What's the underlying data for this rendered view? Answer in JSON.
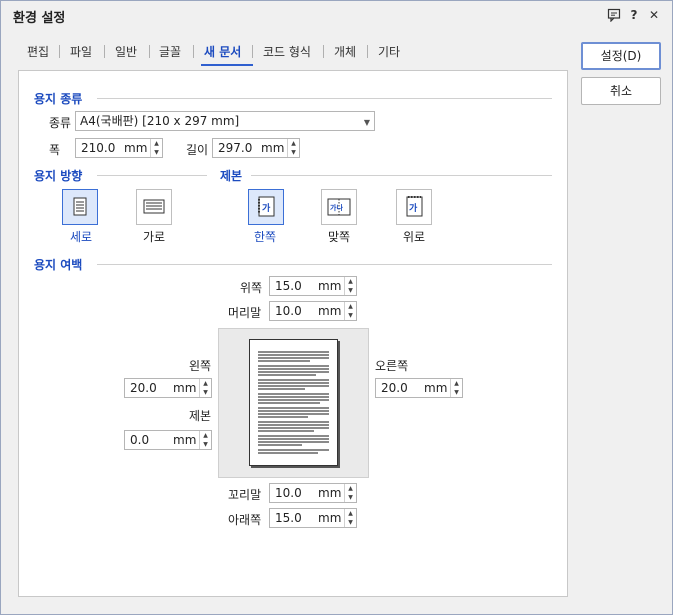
{
  "window": {
    "title": "환경 설정",
    "help_label": "?",
    "close_label": "✕"
  },
  "tabs": [
    {
      "label": "편집"
    },
    {
      "label": "파일"
    },
    {
      "label": "일반"
    },
    {
      "label": "글꼴"
    },
    {
      "label": "새 문서",
      "active": true
    },
    {
      "label": "코드 형식"
    },
    {
      "label": "개체"
    },
    {
      "label": "기타"
    }
  ],
  "buttons": {
    "ok_label": "설정(D)",
    "cancel_label": "취소"
  },
  "paper_type": {
    "section_title": "용지 종류",
    "type_label": "종류",
    "type_value": "A4(국배판) [210 x 297 mm]",
    "width_label": "폭",
    "width_value": "210.0",
    "height_label": "길이",
    "height_value": "297.0",
    "unit": "mm"
  },
  "orientation": {
    "section_title": "용지 방향",
    "portrait_label": "세로",
    "landscape_label": "가로",
    "selected": "세로"
  },
  "binding": {
    "section_title": "제본",
    "single_label": "한쪽",
    "facing_label": "맞쪽",
    "top_label": "위로",
    "selected": "한쪽",
    "glyph": "가",
    "facing_glyph": "가나"
  },
  "margins": {
    "section_title": "용지 여백",
    "top_label": "위쪽",
    "top_value": "15.0",
    "header_label": "머리말",
    "header_value": "10.0",
    "left_label": "왼쪽",
    "left_value": "20.0",
    "gutter_label": "제본",
    "gutter_value": "0.0",
    "right_label": "오른쪽",
    "right_value": "20.0",
    "footer_label": "꼬리말",
    "footer_value": "10.0",
    "bottom_label": "아래쪽",
    "bottom_value": "15.0",
    "unit": "mm"
  },
  "colors": {
    "accent": "#1c4bbf",
    "selected_bg": "#dde8fb"
  }
}
